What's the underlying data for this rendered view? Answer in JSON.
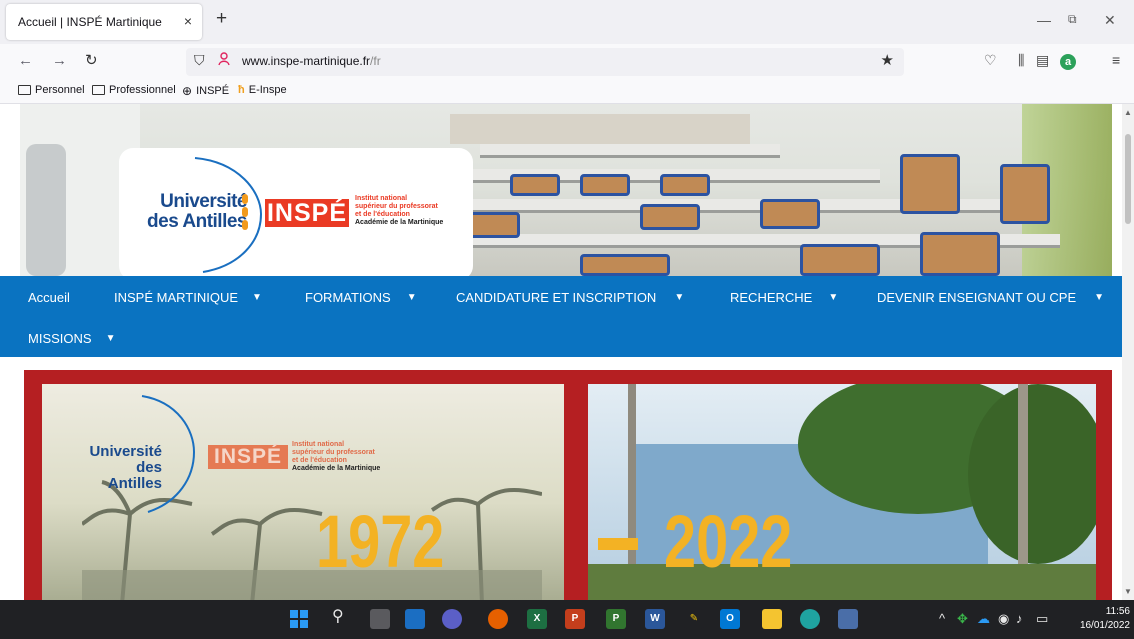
{
  "browser": {
    "tab_title": "Accueil | INSPÉ Martinique",
    "tab_close": "×",
    "new_tab": "+",
    "url_host": "www.inspe-martinique.fr",
    "url_path": "/fr",
    "win_min": "—",
    "win_restore": "⧉",
    "win_close": "✕",
    "bookmarks": [
      "Personnel",
      "Professionnel",
      "INSPÉ",
      "E-Inspe"
    ]
  },
  "header": {
    "ua_line1": "Université",
    "ua_line2": "des Antilles",
    "inspe_logo": "INSPÉ",
    "inspe_desc1": "Institut national",
    "inspe_desc2": "supérieur du professorat",
    "inspe_desc3": "et de l'éducation",
    "inspe_desc4": "Académie de la Martinique"
  },
  "menu": {
    "items": [
      {
        "label": "Accueil",
        "has_caret": false
      },
      {
        "label": "INSPÉ MARTINIQUE",
        "has_caret": true
      },
      {
        "label": "FORMATIONS",
        "has_caret": true
      },
      {
        "label": "CANDIDATURE ET INSCRIPTION",
        "has_caret": true
      },
      {
        "label": "RECHERCHE",
        "has_caret": true
      },
      {
        "label": "DEVENIR ENSEIGNANT OU CPE",
        "has_caret": true
      },
      {
        "label": "MISSIONS",
        "has_caret": true
      }
    ],
    "caret": "▼"
  },
  "banner": {
    "ua_line1": "Université",
    "ua_line2": "des Antilles",
    "inspe_logo": "INSPÉ",
    "inspe_desc1": "Institut national",
    "inspe_desc2": "supérieur du professorat",
    "inspe_desc3": "et de l'éducation",
    "inspe_desc4": "Académie de la Martinique",
    "year_start": "1972",
    "year_end": "2022"
  },
  "taskbar": {
    "clock_time": "11:56",
    "clock_date": "16/01/2022"
  },
  "colors": {
    "menu_bg": "#0a73c1",
    "inspe_red": "#ea3a24",
    "ua_blue": "#1a4a8d",
    "banner_red": "#b51f22",
    "year_gold": "#f3b224"
  }
}
